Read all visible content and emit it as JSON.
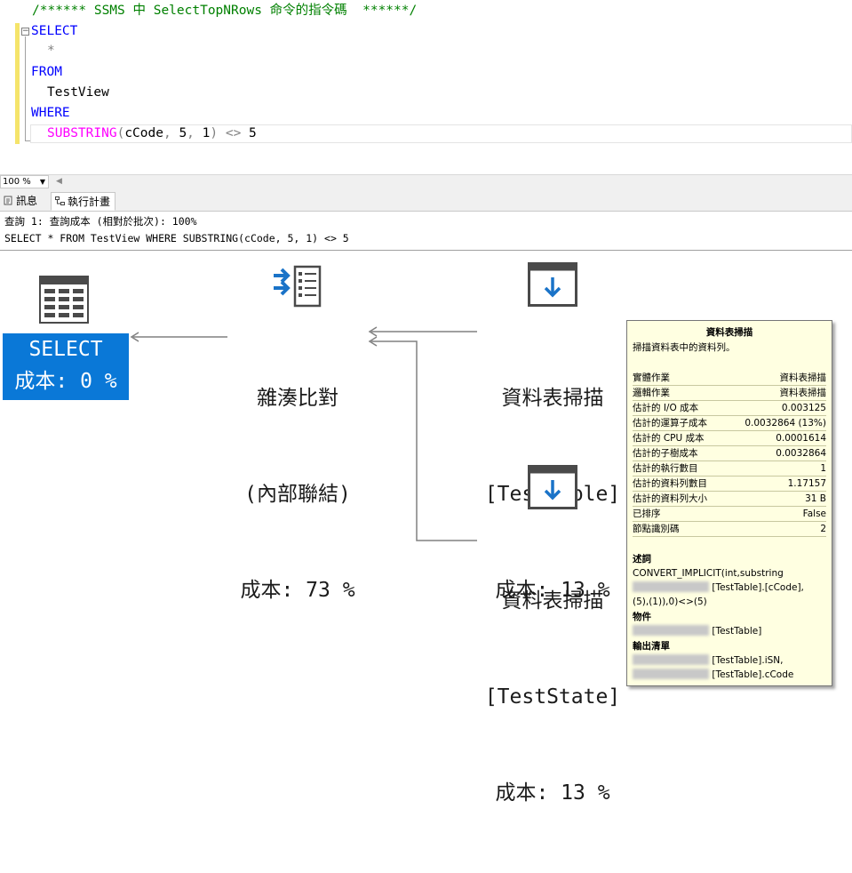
{
  "editor": {
    "comment": "/****** SSMS 中 SelectTopNRows 命令的指令碼  ******/",
    "lines": {
      "select": "SELECT",
      "star": "*",
      "from": "FROM",
      "table": "TestView",
      "where": "WHERE",
      "substring_fn": "SUBSTRING",
      "paren_open": "(",
      "arg1": "cCode",
      "comma1": ",",
      "arg2": "5",
      "comma2": ",",
      "arg3": "1",
      "paren_close": ")",
      "op": "<>",
      "rhs": "5"
    }
  },
  "zoom": {
    "value": "100 %"
  },
  "tabs": [
    {
      "label": "訊息",
      "icon": "messages-icon"
    },
    {
      "label": "執行計畫",
      "icon": "execution-plan-icon"
    }
  ],
  "query": {
    "header": "查詢 1: 查詢成本 (相對於批次): 100%",
    "sql": "SELECT * FROM TestView WHERE SUBSTRING(cCode, 5, 1) <> 5"
  },
  "plan": {
    "select_node": {
      "name": "SELECT",
      "cost": "成本: 0 %",
      "icon": "select-result-icon"
    },
    "join_node": {
      "name": "雜湊比對",
      "sub": "(內部聯結)",
      "cost": "成本: 73 %",
      "icon": "hash-match-icon"
    },
    "scan_node_1": {
      "name": "資料表掃描",
      "object": "[TestTable]",
      "cost": "成本: 13 %",
      "icon": "table-scan-icon"
    },
    "scan_node_2": {
      "name": "資料表掃描",
      "object": "[TestState]",
      "cost": "成本: 13 %",
      "icon": "table-scan-icon"
    }
  },
  "tooltip": {
    "title": "資料表掃描",
    "description": "掃描資料表中的資料列。",
    "rows": [
      {
        "key": "實體作業",
        "value": "資料表掃描"
      },
      {
        "key": "邏輯作業",
        "value": "資料表掃描"
      },
      {
        "key": "估計的 I/O 成本",
        "value": "0.003125"
      },
      {
        "key": "估計的運算子成本",
        "value": "0.0032864 (13%)"
      },
      {
        "key": "估計的 CPU 成本",
        "value": "0.0001614"
      },
      {
        "key": "估計的子樹成本",
        "value": "0.0032864"
      },
      {
        "key": "估計的執行數目",
        "value": "1"
      },
      {
        "key": "估計的資料列數目",
        "value": "1.17157"
      },
      {
        "key": "估計的資料列大小",
        "value": "31 B"
      },
      {
        "key": "已排序",
        "value": "False"
      },
      {
        "key": "節點識別碼",
        "value": "2"
      }
    ],
    "predicate_label": "述詞",
    "predicate_line1": "CONVERT_IMPLICIT(int,substring",
    "predicate_line2": "[TestTable].[cCode],",
    "predicate_line3": "(5),(1)),0)<>(5)",
    "object_label": "物件",
    "object_value": "[TestTable]",
    "output_label": "輸出清單",
    "output_line1": "[TestTable].iSN,",
    "output_line2": "[TestTable].cCode"
  }
}
